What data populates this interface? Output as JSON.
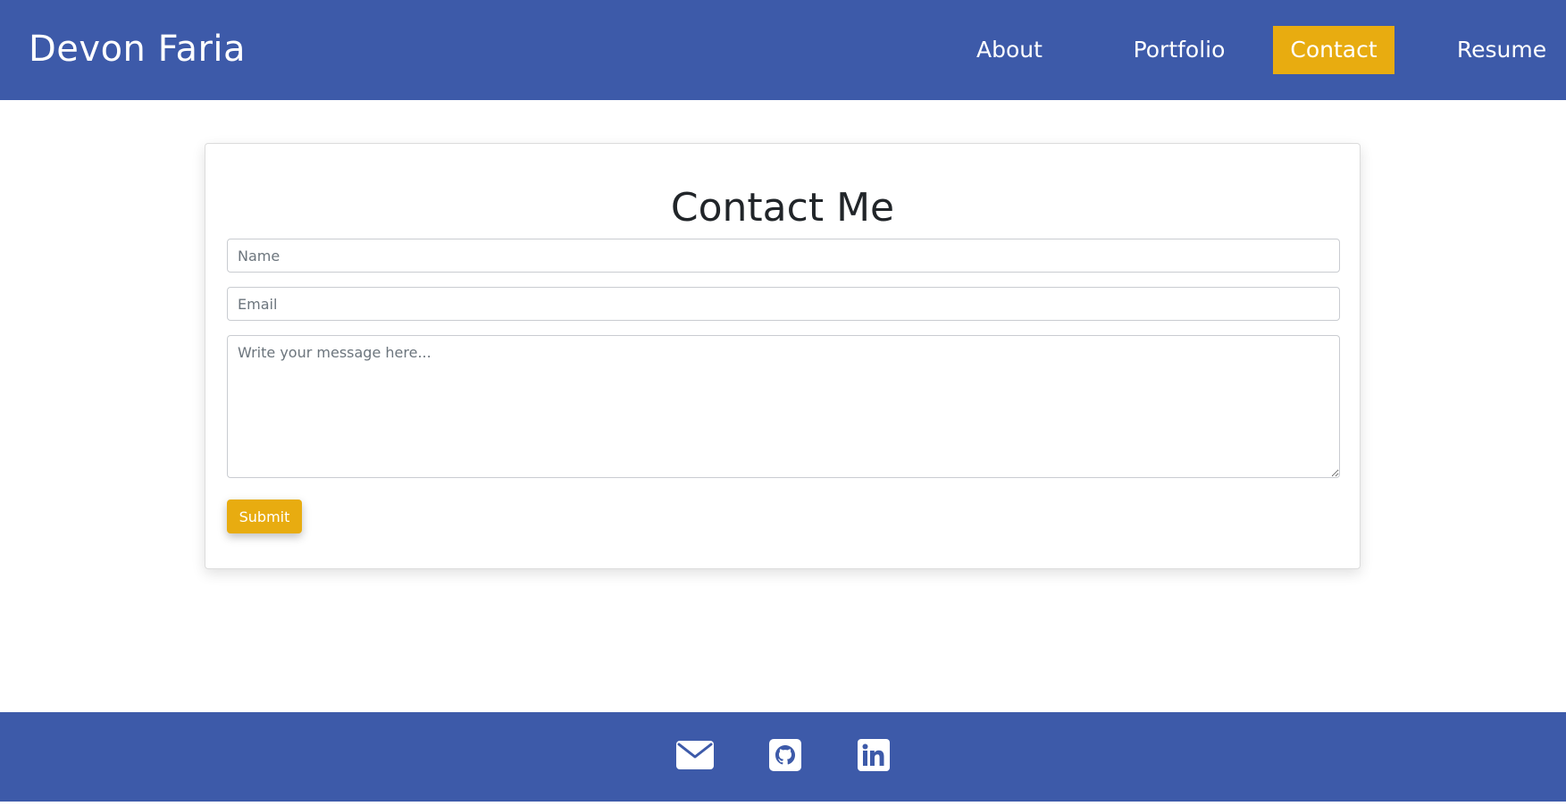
{
  "header": {
    "brand": "Devon Faria",
    "nav": [
      {
        "label": "About",
        "active": false
      },
      {
        "label": "Portfolio",
        "active": false
      },
      {
        "label": "Contact",
        "active": true
      },
      {
        "label": "Resume",
        "active": false
      }
    ]
  },
  "contact_form": {
    "title": "Contact Me",
    "name_placeholder": "Name",
    "email_placeholder": "Email",
    "message_placeholder": "Write your message here...",
    "submit_label": "Submit"
  },
  "footer": {
    "icons": [
      "envelope-icon",
      "github-icon",
      "linkedin-icon"
    ]
  },
  "colors": {
    "primary": "#3d5aa9",
    "accent": "#e8ac10",
    "background": "#ffffff"
  }
}
